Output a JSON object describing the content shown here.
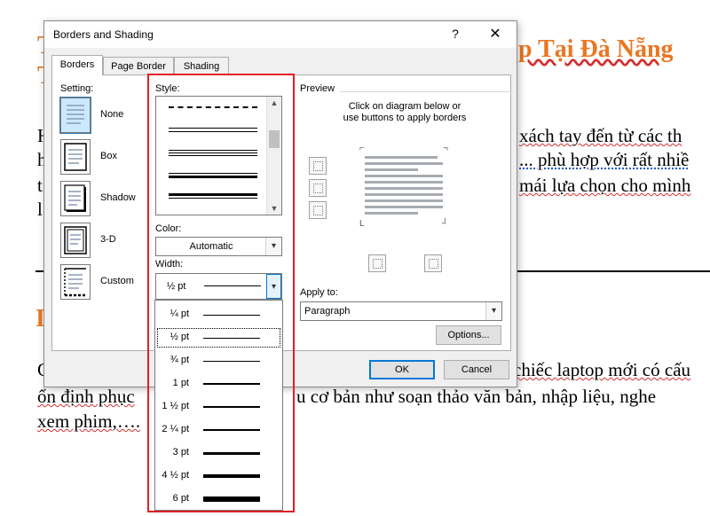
{
  "document": {
    "heading1": "p Tại Đà Nẵng",
    "line_h": "H",
    "line2a": "xách tay đến từ các th",
    "line_h2": "h",
    "line3a": "... phù hợp với rất nhiề",
    "line_t": "t",
    "line4a": "mái lựa chọn cho mình",
    "line_l": "l",
    "heading2_letter": "I",
    "para_c": "C",
    "para2a": "chiếc laptop mới có cấu",
    "para3a": "ổn định phục",
    "para3b": "u cơ bản như soạn thảo văn bản, nhập liệu, nghe",
    "para4": "xem phim,…."
  },
  "dialog": {
    "title": "Borders and Shading",
    "help_glyph": "?",
    "close_glyph": "✕",
    "tabs": [
      "Borders",
      "Page Border",
      "Shading"
    ],
    "setting_label": "Setting:",
    "settings": [
      "None",
      "Box",
      "Shadow",
      "3-D",
      "Custom"
    ],
    "style_label": "Style:",
    "color_label": "Color:",
    "color_value": "Automatic",
    "width_label": "Width:",
    "width_value": "½ pt",
    "preview_label": "Preview",
    "preview_hint_1": "Click on diagram below or",
    "preview_hint_2": "use buttons to apply borders",
    "apply_to_label": "Apply to:",
    "apply_to_value": "Paragraph",
    "options_button": "Options...",
    "ok_button": "OK",
    "cancel_button": "Cancel"
  },
  "width_options": [
    "¼ pt",
    "½ pt",
    "¾ pt",
    "1 pt",
    "1 ½ pt",
    "2 ¼ pt",
    "3 pt",
    "4 ½ pt",
    "6 pt"
  ],
  "selected_width_index": 1,
  "colors": {
    "highlight": "#e31e24",
    "heading": "#e87722",
    "selection_blue": "#0078d7"
  }
}
